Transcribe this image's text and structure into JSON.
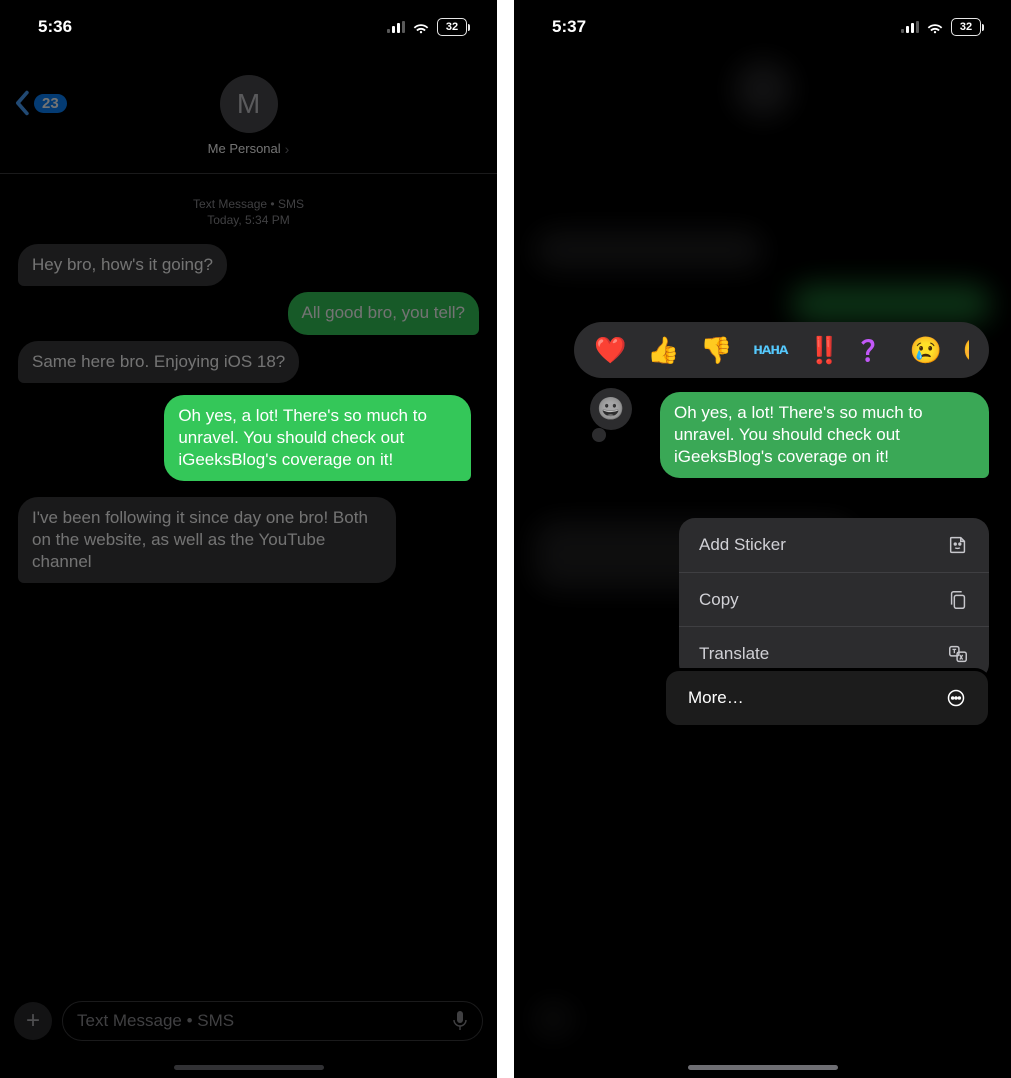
{
  "left": {
    "status": {
      "time": "5:36",
      "battery": "32"
    },
    "back_count": "23",
    "avatar_initial": "M",
    "contact_name": "Me Personal",
    "system_line1": "Text Message • SMS",
    "system_line2": "Today, 5:34 PM",
    "messages": [
      {
        "side": "left",
        "text": "Hey bro, how's it going?"
      },
      {
        "side": "right",
        "text": "All good bro, you tell?"
      },
      {
        "side": "left",
        "text": "Same here bro. Enjoying iOS 18?"
      },
      {
        "side": "right",
        "highlight": true,
        "text": "Oh yes, a lot! There's so much to unravel. You should check out iGeeksBlog's coverage on it!"
      },
      {
        "side": "left",
        "text": "I've been following it since day one bro! Both on the website, as well as the YouTube channel"
      }
    ],
    "compose_placeholder": "Text Message • SMS"
  },
  "right": {
    "status": {
      "time": "5:37",
      "battery": "32"
    },
    "reactions": [
      "❤️",
      "👍",
      "👎",
      "ʜᴀʜᴀ",
      "‼️",
      "？",
      "😢",
      "😊"
    ],
    "tapback_emoji": "😀",
    "focused_message": "Oh yes, a lot! There's so much to unravel. You should check out iGeeksBlog's coverage on it!",
    "actions": [
      {
        "label": "Add Sticker",
        "icon": "sticker"
      },
      {
        "label": "Copy",
        "icon": "copy"
      },
      {
        "label": "Translate",
        "icon": "translate"
      }
    ],
    "more_label": "More…"
  }
}
